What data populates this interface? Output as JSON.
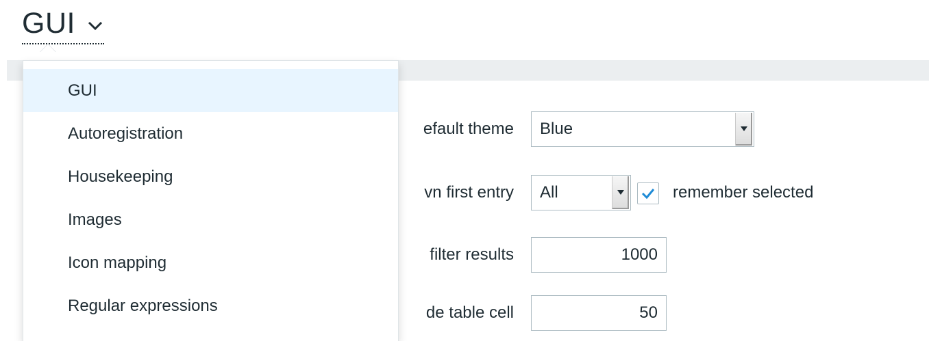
{
  "page": {
    "title": "GUI"
  },
  "colors": {
    "selected_bg": "#e8f5ff",
    "header_strip": "#ebeef0",
    "checkbox_check": "#1f8bd6",
    "text": "#1f2c33"
  },
  "icons": {
    "title_dropdown": "chevron-down-icon",
    "checkbox": "check-icon",
    "select_arrow": "triangle-down-icon"
  },
  "menu": {
    "items": [
      {
        "label": "GUI",
        "selected": true
      },
      {
        "label": "Autoregistration",
        "selected": false
      },
      {
        "label": "Housekeeping",
        "selected": false
      },
      {
        "label": "Images",
        "selected": false
      },
      {
        "label": "Icon mapping",
        "selected": false
      },
      {
        "label": "Regular expressions",
        "selected": false
      }
    ]
  },
  "form": {
    "default_theme": {
      "label_visible": "efault theme",
      "value": "Blue"
    },
    "dropdown_first_entry": {
      "label_visible": "vn first entry",
      "value": "All",
      "remember_checked": true,
      "remember_label": "remember selected"
    },
    "filter_results": {
      "label_visible": "filter results",
      "value": "1000"
    },
    "table_cell": {
      "label_visible": "de table cell",
      "value": "50"
    }
  }
}
